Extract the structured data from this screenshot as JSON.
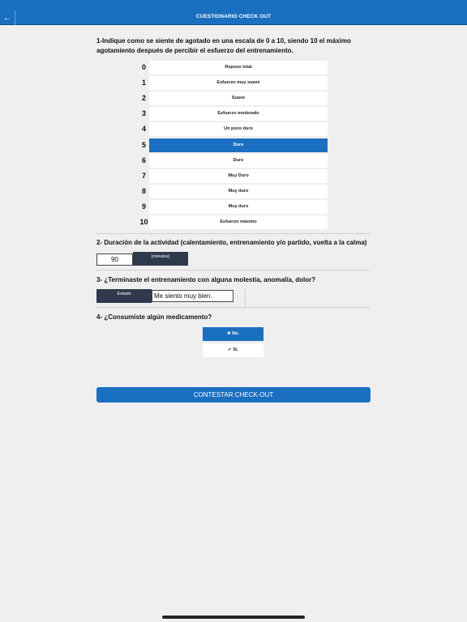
{
  "header": {
    "title": "CUESTIONARIO CHECK OUT",
    "back_icon": "←"
  },
  "q1": {
    "title": "1-Indique como se siente de agotado en una escala de 0 a 10, siendo 10 el máximo agotamiento después de percibir el esfuerzo del entrenamiento.",
    "options": [
      {
        "num": "0",
        "label": "Reposo total"
      },
      {
        "num": "1",
        "label": "Esfuerzo muy suave"
      },
      {
        "num": "2",
        "label": "Suave"
      },
      {
        "num": "3",
        "label": "Esfuerzo moderado"
      },
      {
        "num": "4",
        "label": "Un poco duro"
      },
      {
        "num": "5",
        "label": "Duro"
      },
      {
        "num": "6",
        "label": "Duro"
      },
      {
        "num": "7",
        "label": "Muy Duro"
      },
      {
        "num": "8",
        "label": "Muy duro"
      },
      {
        "num": "9",
        "label": "Muy duro"
      },
      {
        "num": "10",
        "label": "Esfuerzo máximo"
      }
    ],
    "selected": "5"
  },
  "q2": {
    "title": "2- Duración de la actividad (calentamiento, entrenamiento y/o partido, vuelta a la calma)",
    "value": "90",
    "unit": "(minutos)"
  },
  "q3": {
    "title": "3- ¿Terminaste el entrenamiento con alguna molestia, anomalía, dolor?",
    "label": "Estado",
    "value": "Me siento muy bien."
  },
  "q4": {
    "title": "4- ¿Consumiste algún medicamento?",
    "no_label": "✖ No.",
    "si_label": "✔ Si.",
    "selected": "no"
  },
  "submit": {
    "label": "CONTESTAR CHECK-OUT"
  },
  "colors": {
    "primary": "#1a6fc0",
    "dark": "#2e3a4c",
    "background": "#efefef"
  }
}
